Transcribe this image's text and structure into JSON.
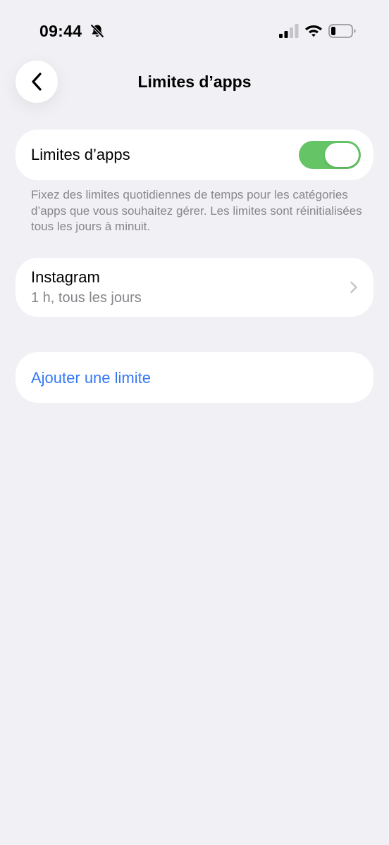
{
  "status_bar": {
    "time": "09:44",
    "icons": [
      "bell-slash-icon",
      "cellular-signal-icon",
      "wifi-icon",
      "battery-low-icon"
    ]
  },
  "nav": {
    "back_icon": "chevron-left-icon",
    "title": "Limites d’apps"
  },
  "toggle_section": {
    "label": "Limites d’apps",
    "enabled": true,
    "footnote": "Fixez des limites quotidiennes de temps pour les catégories d’apps que vous souhaitez gérer. Les limites sont réinitialisées tous les jours à minuit."
  },
  "limits": [
    {
      "app": "Instagram",
      "detail": "1 h, tous les jours"
    }
  ],
  "add_limit": {
    "label": "Ajouter une limite"
  },
  "colors": {
    "background": "#f0f0f5",
    "toggle_on": "#65c466",
    "link": "#3478f6",
    "secondary_text": "#86868b"
  }
}
